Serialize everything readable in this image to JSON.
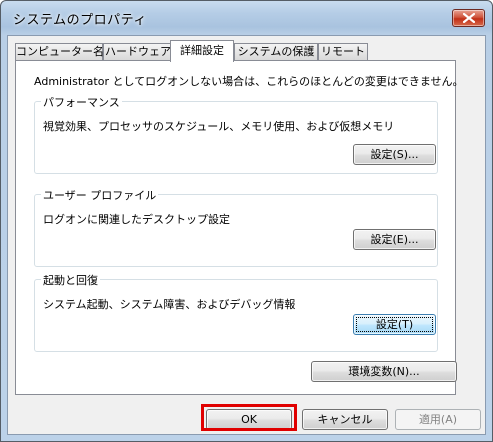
{
  "window": {
    "title": "システムのプロパティ"
  },
  "tabs": [
    {
      "label": "コンピューター名",
      "active": false
    },
    {
      "label": "ハードウェア",
      "active": false
    },
    {
      "label": "詳細設定",
      "active": true
    },
    {
      "label": "システムの保護",
      "active": false
    },
    {
      "label": "リモート",
      "active": false
    }
  ],
  "panel": {
    "intro": "Administrator としてログオンしない場合は、これらのほとんどの変更はできません。",
    "performance": {
      "title": "パフォーマンス",
      "description": "視覚効果、プロセッサのスケジュール、メモリ使用、および仮想メモリ",
      "button": "設定(S)..."
    },
    "user_profile": {
      "title": "ユーザー プロファイル",
      "description": "ログオンに関連したデスクトップ設定",
      "button": "設定(E)..."
    },
    "startup_recovery": {
      "title": "起動と回復",
      "description": "システム起動、システム障害、およびデバッグ情報",
      "button": "設定(T)"
    },
    "env_button": "環境変数(N)..."
  },
  "footer": {
    "ok": "OK",
    "cancel": "キャンセル",
    "apply": "適用(A)"
  },
  "colors": {
    "highlight": "#e00000",
    "title_gradient": "#b5cde6"
  }
}
